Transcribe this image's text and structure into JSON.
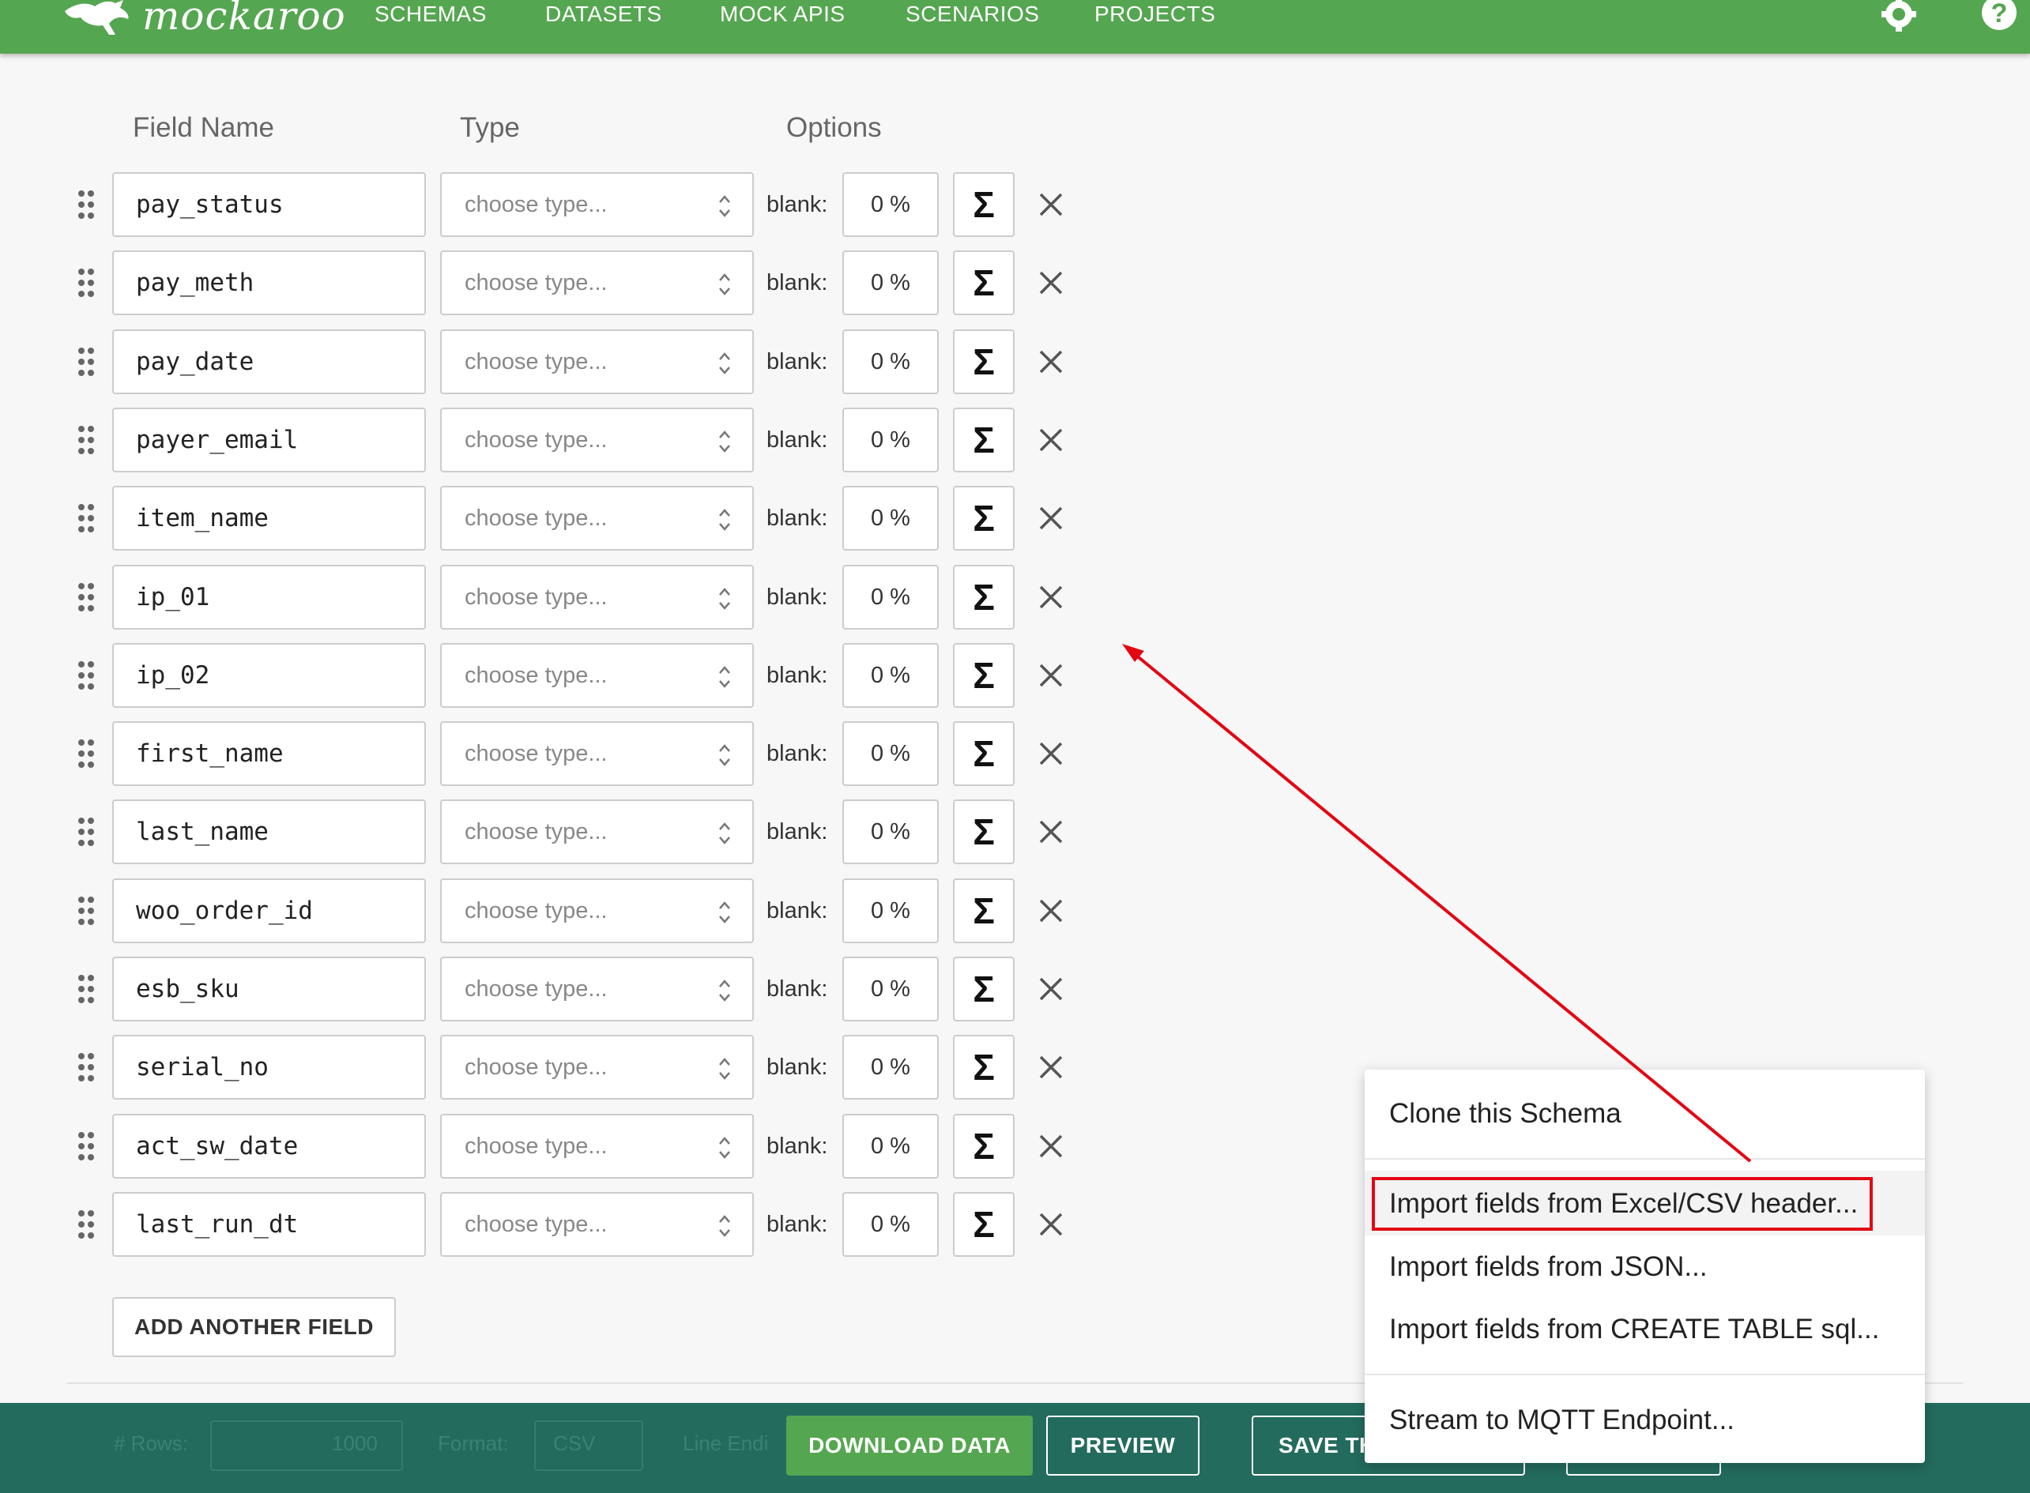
{
  "app": {
    "logo_text": "mockaroo",
    "nav": [
      "SCHEMAS",
      "DATASETS",
      "MOCK APIS",
      "SCENARIOS",
      "PROJECTS"
    ]
  },
  "columns": {
    "field_name": "Field Name",
    "type": "Type",
    "options": "Options"
  },
  "fields": [
    {
      "name": "pay_status",
      "type_placeholder": "choose type...",
      "blank_label": "blank:",
      "blank_pct": "0 %",
      "sigma": "Σ"
    },
    {
      "name": "pay_meth",
      "type_placeholder": "choose type...",
      "blank_label": "blank:",
      "blank_pct": "0 %",
      "sigma": "Σ"
    },
    {
      "name": "pay_date",
      "type_placeholder": "choose type...",
      "blank_label": "blank:",
      "blank_pct": "0 %",
      "sigma": "Σ"
    },
    {
      "name": "payer_email",
      "type_placeholder": "choose type...",
      "blank_label": "blank:",
      "blank_pct": "0 %",
      "sigma": "Σ"
    },
    {
      "name": "item_name",
      "type_placeholder": "choose type...",
      "blank_label": "blank:",
      "blank_pct": "0 %",
      "sigma": "Σ"
    },
    {
      "name": "ip_01",
      "type_placeholder": "choose type...",
      "blank_label": "blank:",
      "blank_pct": "0 %",
      "sigma": "Σ"
    },
    {
      "name": "ip_02",
      "type_placeholder": "choose type...",
      "blank_label": "blank:",
      "blank_pct": "0 %",
      "sigma": "Σ"
    },
    {
      "name": "first_name",
      "type_placeholder": "choose type...",
      "blank_label": "blank:",
      "blank_pct": "0 %",
      "sigma": "Σ"
    },
    {
      "name": "last_name",
      "type_placeholder": "choose type...",
      "blank_label": "blank:",
      "blank_pct": "0 %",
      "sigma": "Σ"
    },
    {
      "name": "woo_order_id",
      "type_placeholder": "choose type...",
      "blank_label": "blank:",
      "blank_pct": "0 %",
      "sigma": "Σ"
    },
    {
      "name": "esb_sku",
      "type_placeholder": "choose type...",
      "blank_label": "blank:",
      "blank_pct": "0 %",
      "sigma": "Σ"
    },
    {
      "name": "serial_no",
      "type_placeholder": "choose type...",
      "blank_label": "blank:",
      "blank_pct": "0 %",
      "sigma": "Σ"
    },
    {
      "name": "act_sw_date",
      "type_placeholder": "choose type...",
      "blank_label": "blank:",
      "blank_pct": "0 %",
      "sigma": "Σ"
    },
    {
      "name": "last_run_dt",
      "type_placeholder": "choose type...",
      "blank_label": "blank:",
      "blank_pct": "0 %",
      "sigma": "Σ"
    }
  ],
  "add_field_label": "ADD ANOTHER FIELD",
  "bottom_bar": {
    "rows_label": "# Rows:",
    "rows_value": "1000",
    "format_label": "Format:",
    "format_value": "CSV",
    "line_ending_label": "Line Endi",
    "download_label": "DOWNLOAD DATA",
    "preview_label": "PREVIEW",
    "save_label": "SAVE TH"
  },
  "menu": {
    "clone": "Clone this Schema",
    "import_csv": "Import fields from Excel/CSV header...",
    "import_json": "Import fields from JSON...",
    "import_sql": "Import fields from CREATE TABLE sql...",
    "mqtt": "Stream to MQTT Endpoint..."
  },
  "colors": {
    "brand_green": "#55a650",
    "bottom_bar": "#236b5d",
    "annotation_red": "#e30613"
  },
  "icons": {
    "logo": "kangaroo-icon",
    "settings": "gear-icon",
    "help": "help-icon",
    "drag": "drag-handle-icon",
    "select": "updown-chevron-icon",
    "formula": "sigma-icon",
    "remove": "close-icon"
  }
}
